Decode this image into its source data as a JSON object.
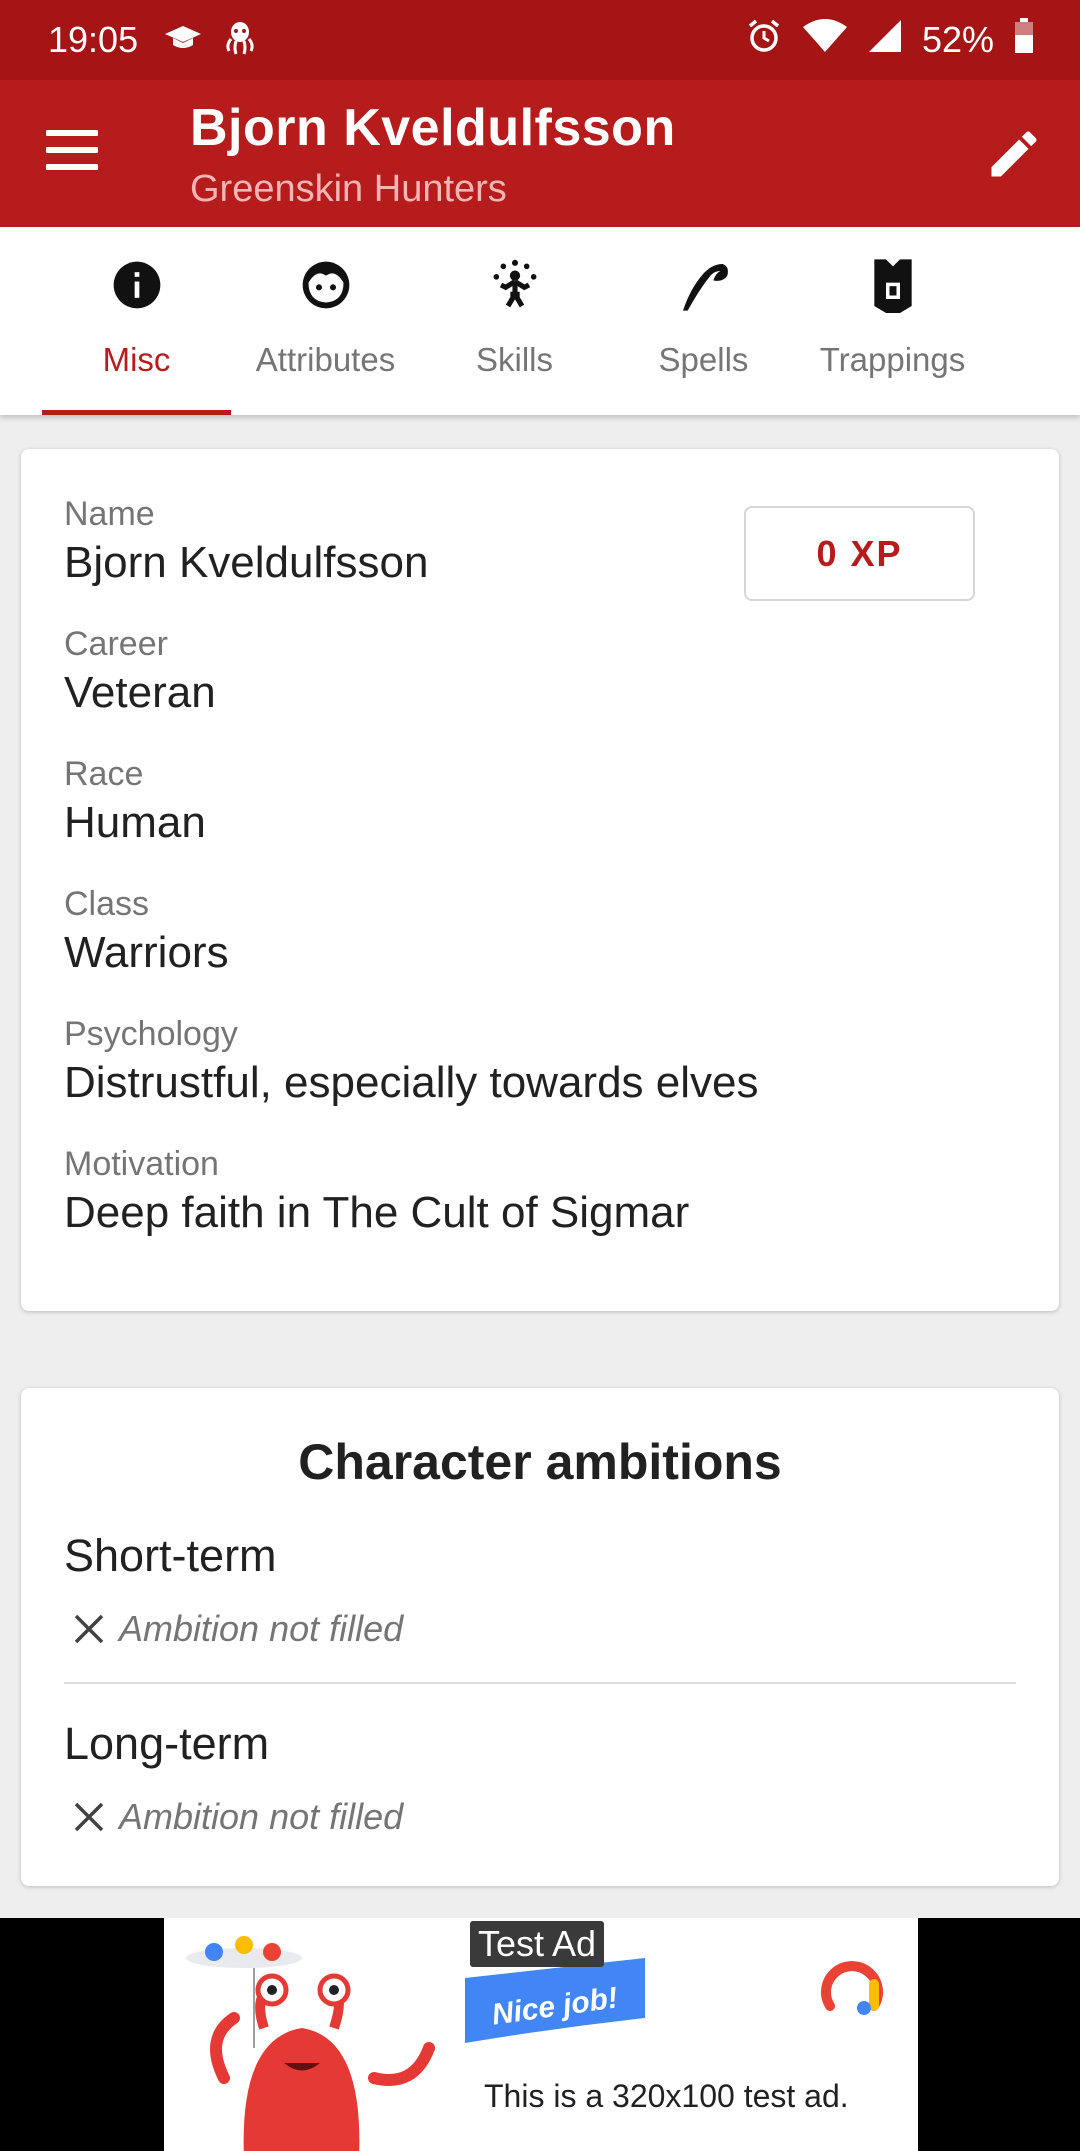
{
  "status_bar": {
    "time": "19:05",
    "battery": "52%",
    "icons": [
      "graduation-cap-icon",
      "octopus-icon",
      "alarm-icon",
      "wifi-icon",
      "signal-icon",
      "battery-icon"
    ]
  },
  "app_bar": {
    "title": "Bjorn Kveldulfsson",
    "subtitle": "Greenskin Hunters",
    "accent_color": "#b71c1c"
  },
  "tabs": [
    {
      "label": "Misc",
      "icon": "info-icon",
      "active": true
    },
    {
      "label": "Attributes",
      "icon": "face-icon",
      "active": false
    },
    {
      "label": "Skills",
      "icon": "juggler-icon",
      "active": false
    },
    {
      "label": "Spells",
      "icon": "quill-icon",
      "active": false
    },
    {
      "label": "Trappings",
      "icon": "armor-icon",
      "active": false
    }
  ],
  "misc": {
    "xp_label": "0 XP",
    "fields": [
      {
        "label": "Name",
        "value": "Bjorn Kveldulfsson"
      },
      {
        "label": "Career",
        "value": "Veteran"
      },
      {
        "label": "Race",
        "value": "Human"
      },
      {
        "label": "Class",
        "value": "Warriors"
      },
      {
        "label": "Psychology",
        "value": "Distrustful, especially towards elves"
      },
      {
        "label": "Motivation",
        "value": "Deep faith in The Cult of Sigmar"
      }
    ]
  },
  "ambitions": {
    "title": "Character ambitions",
    "short_term": {
      "label": "Short-term",
      "status": "Ambition not filled"
    },
    "long_term": {
      "label": "Long-term",
      "status": "Ambition not filled"
    }
  },
  "ad": {
    "badge": "Test Ad",
    "banner_text": "Nice job!",
    "text": "This is a 320x100 test ad."
  }
}
